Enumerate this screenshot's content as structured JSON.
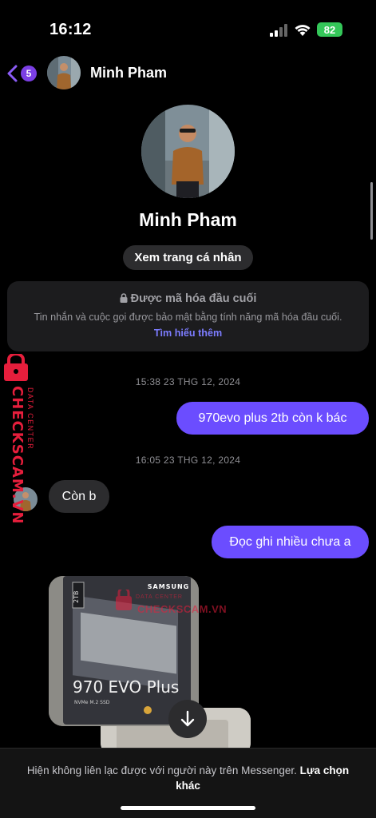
{
  "status_bar": {
    "time": "16:12",
    "battery": "82"
  },
  "header": {
    "back_count": "5",
    "contact_name": "Minh Pham"
  },
  "profile": {
    "name": "Minh Pham",
    "view_profile_label": "Xem trang cá nhân"
  },
  "encryption": {
    "title": "Được mã hóa đầu cuối",
    "description": "Tin nhắn và cuộc gọi được bảo mật bằng tính năng mã hóa đầu cuối.",
    "link": "Tìm hiểu thêm"
  },
  "conversation": {
    "timestamp_1": "15:38 23 THG 12, 2024",
    "msg_out_1": "970evo plus 2tb còn k bác",
    "timestamp_2": "16:05 23 THG 12, 2024",
    "msg_in_1": "Còn b",
    "msg_out_2": "Đọc ghi nhiều chưa a"
  },
  "product_image": {
    "brand": "SAMSUNG",
    "capacity": "2TB",
    "model": "970 EVO Plus",
    "sub": "NVMe M.2 SSD"
  },
  "watermark": {
    "brand": "CHECKSCAM.VN",
    "sub": "DATA CENTER"
  },
  "footer": {
    "text": "Hiện không liên lạc được với người này trên Messenger.",
    "link": "Lựa chọn khác"
  },
  "colors": {
    "outgoing_bubble": "#6b4dff",
    "incoming_bubble": "#2c2c2e",
    "link": "#7c7cff",
    "battery": "#34c759",
    "watermark": "#e61e3c"
  }
}
